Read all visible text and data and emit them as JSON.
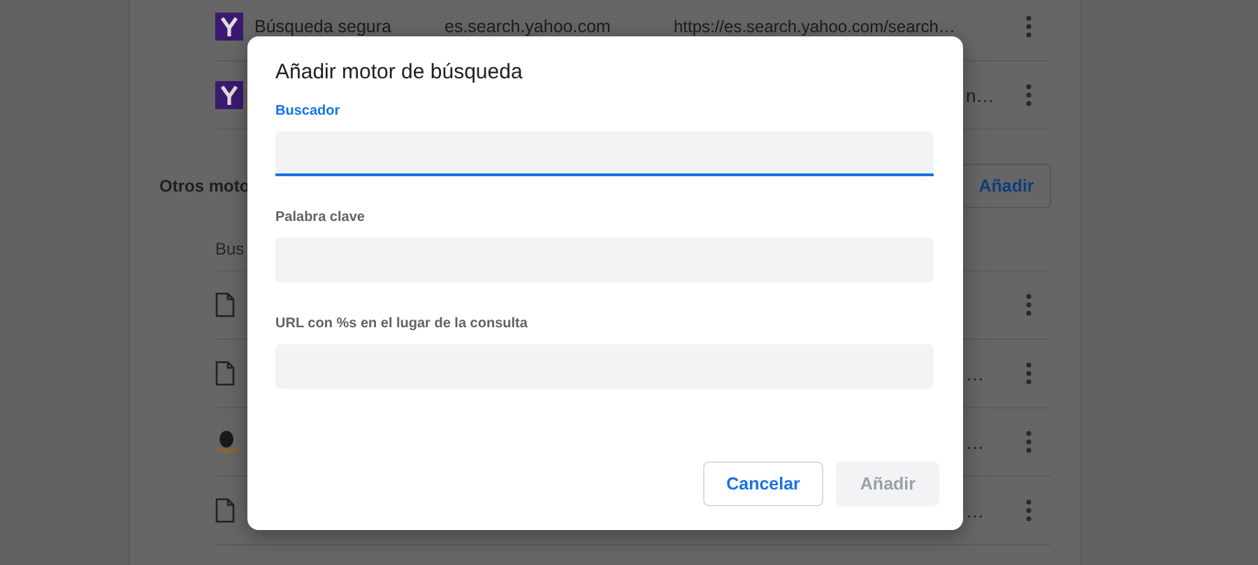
{
  "background": {
    "rows": [
      {
        "kind": "yahoo",
        "name": "Búsqueda segura",
        "keyword": "es.search.yahoo.com",
        "url": "https://es.search.yahoo.com/search…"
      },
      {
        "kind": "yahoo",
        "url": "n…"
      }
    ],
    "section": {
      "title": "Otros moto",
      "add_button": "Añadir",
      "column_header": "Bus",
      "rows": [
        {
          "kind": "file"
        },
        {
          "kind": "file",
          "url": "…"
        },
        {
          "kind": "amazon",
          "url": "…"
        },
        {
          "kind": "file",
          "url": "…"
        }
      ]
    }
  },
  "dialog": {
    "title": "Añadir motor de búsqueda",
    "fields": [
      {
        "label": "Buscador",
        "focused": true
      },
      {
        "label": "Palabra clave",
        "focused": false
      },
      {
        "label": "URL con %s en el lugar de la consulta",
        "focused": false
      }
    ],
    "buttons": [
      {
        "label": "Cancelar",
        "kind": "cancel",
        "disabled": false
      },
      {
        "label": "Añadir",
        "kind": "confirm",
        "disabled": true
      }
    ]
  }
}
